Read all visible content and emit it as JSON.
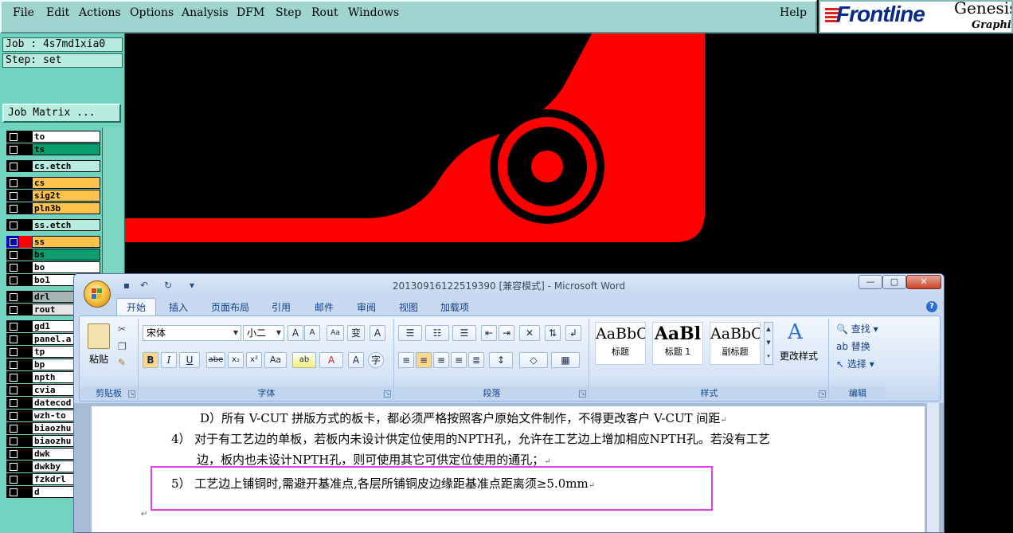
{
  "menu": [
    "File",
    "Edit",
    "Actions",
    "Options",
    "Analysis",
    "DFM",
    "Step",
    "Rout",
    "Windows"
  ],
  "menu_help": "Help",
  "brand": {
    "name": "Frontline",
    "product": "Genesis",
    "sub": "Graphic"
  },
  "job": "Job : 4s7md1xia0",
  "step": "Step: set",
  "job_matrix": "Job Matrix ...",
  "layers": [
    {
      "name": "to",
      "color": "#ffffff"
    },
    {
      "name": "ts",
      "color": "#0a9e6e"
    },
    {
      "name": "cs.etch",
      "color": "#b7ecde"
    },
    {
      "name": "cs",
      "color": "#ffc24a"
    },
    {
      "name": "sig2t",
      "color": "#ffc24a"
    },
    {
      "name": "pln3b",
      "color": "#ffc24a"
    },
    {
      "name": "ss.etch",
      "color": "#b7ecde"
    },
    {
      "name": "ss",
      "color": "#ffc24a"
    },
    {
      "name": "bs",
      "color": "#0a9e6e"
    },
    {
      "name": "bo",
      "color": "#ffffff"
    },
    {
      "name": "bo1",
      "color": "#ffffff"
    },
    {
      "name": "drl",
      "color": "#a7b4b4"
    },
    {
      "name": "rout",
      "color": "#e6e6e6"
    },
    {
      "name": "gd1",
      "color": "#ffffff"
    },
    {
      "name": "panel.a",
      "color": "#ffffff"
    },
    {
      "name": "tp",
      "color": "#ffffff"
    },
    {
      "name": "bp",
      "color": "#ffffff"
    },
    {
      "name": "npth",
      "color": "#ffffff"
    },
    {
      "name": "cvia",
      "color": "#ffffff"
    },
    {
      "name": "datecod",
      "color": "#ffffff"
    },
    {
      "name": "wzh-to",
      "color": "#ffffff"
    },
    {
      "name": "biaozhu",
      "color": "#ffffff"
    },
    {
      "name": "biaozhu",
      "color": "#ffffff"
    },
    {
      "name": "dwk",
      "color": "#ffffff"
    },
    {
      "name": "dwkby",
      "color": "#ffffff"
    },
    {
      "name": "fzkdrl",
      "color": "#ffffff"
    },
    {
      "name": "d",
      "color": "#ffffff"
    }
  ],
  "word": {
    "title": "20130916122519390 [兼容模式] - Microsoft Word",
    "tabs": [
      "开始",
      "插入",
      "页面布局",
      "引用",
      "邮件",
      "审阅",
      "视图",
      "加载项"
    ],
    "font_name": "宋体",
    "font_size": "小二",
    "paste_label": "粘贴",
    "groups": [
      "剪贴板",
      "字体",
      "段落",
      "样式",
      "编辑"
    ],
    "styles": [
      {
        "sample": "AaBbC",
        "name": "标题"
      },
      {
        "sample": "AaBl",
        "name": "标题 1"
      },
      {
        "sample": "AaBbC",
        "name": "副标题"
      }
    ],
    "change_styles": "更改样式",
    "edit_find": "查找",
    "edit_replace": "替换",
    "edit_select": "选择",
    "doc_lines": [
      "D）所有 V-CUT 拼版方式的板卡，都必须严格按照客户原始文件制作，不得更改客户 V-CUT 间距",
      "4） 对于有工艺边的单板，若板内未设计供定位使用的NPTH孔，允许在工艺边上增加相应NPTH孔。若没有工艺",
      "边，板内也未设计NPTH孔，则可使用其它可供定位使用的通孔；",
      "5）  工艺边上铺铜时,需避开基准点,各层所铺铜皮边缘距基准点距离须≥5.0mm"
    ]
  },
  "colors": {
    "genesis_bg": "#9fd3cf",
    "feature_red": "#ff0000",
    "word_ribbon": "#c6d9f1",
    "highlight_box": "#e040e8"
  }
}
